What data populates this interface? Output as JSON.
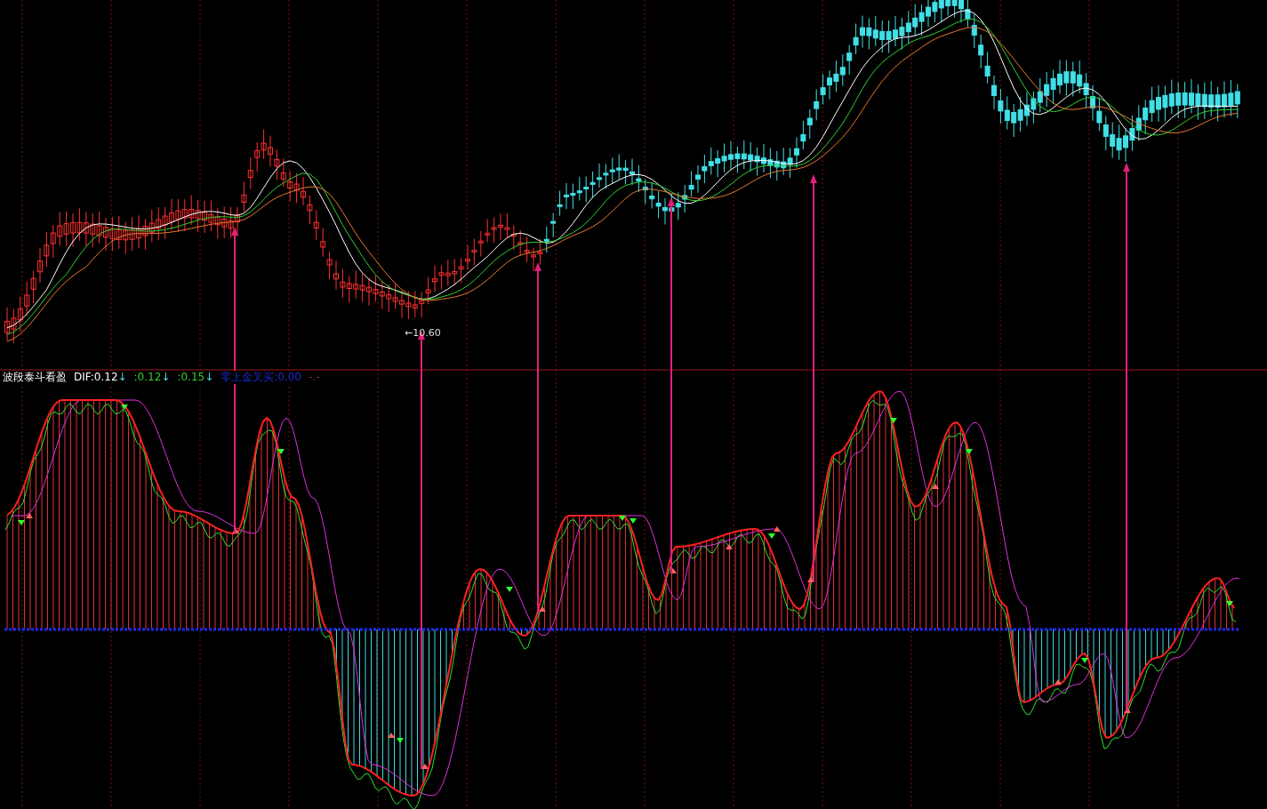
{
  "price_panel": {
    "low_label": "←10.60"
  },
  "indicator_panel": {
    "name": "波段泰斗看盈",
    "legend": [
      {
        "text": "DIF:0.12",
        "arrow": "↓",
        "color": "#ffffff"
      },
      {
        "text": ":0.12",
        "arrow": "↓",
        "color": "#33cc33"
      },
      {
        "text": ":0.15",
        "arrow": "↓",
        "color": "#33cc33"
      },
      {
        "text": "零上金叉买:0.00",
        "color": "#1a2ad0"
      },
      {
        "text": "-.-",
        "color": "#8a3a3a"
      }
    ]
  }
}
